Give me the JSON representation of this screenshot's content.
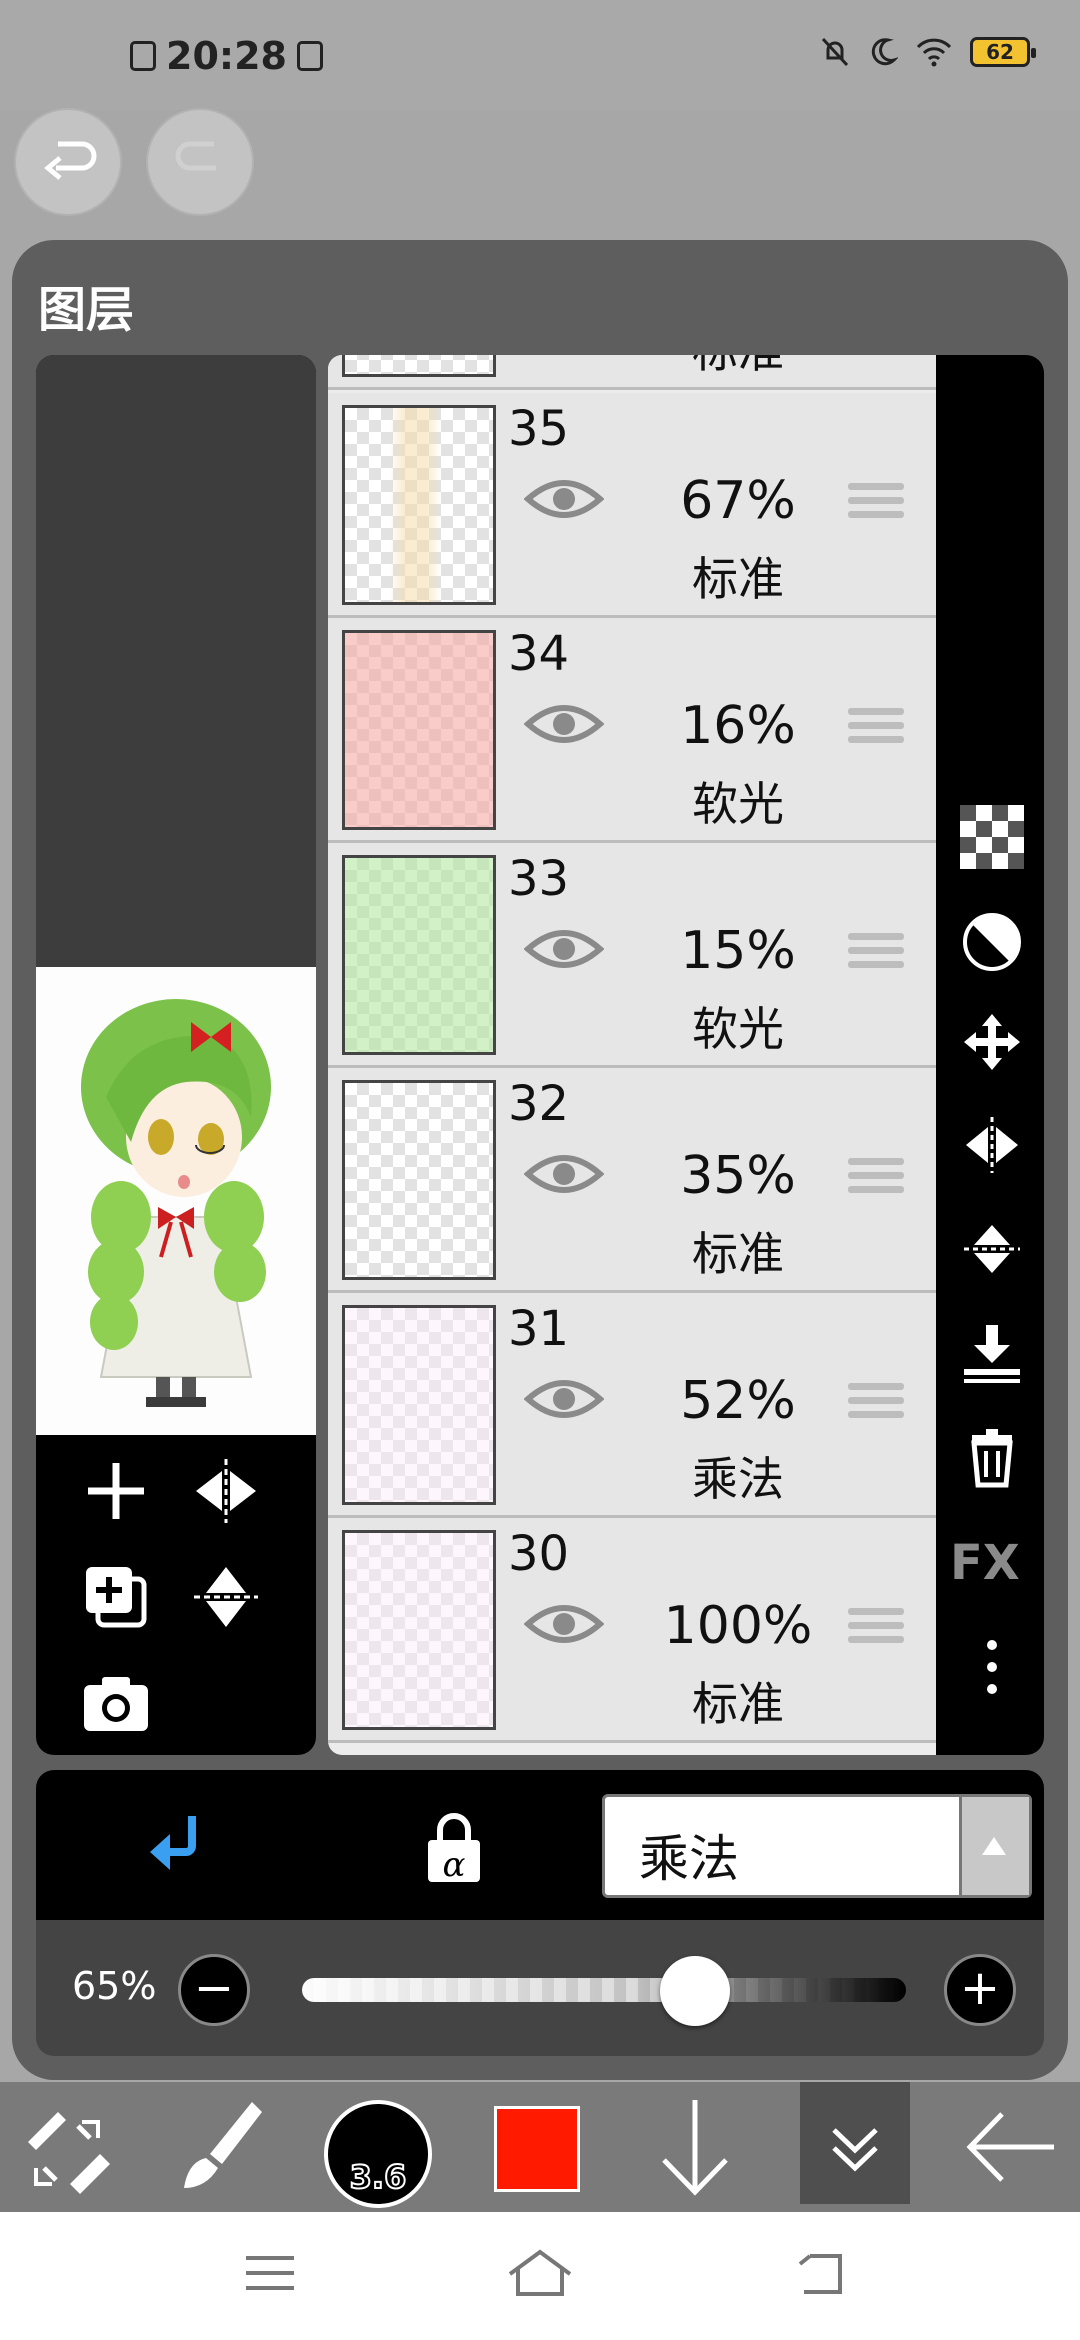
{
  "status_bar": {
    "time": "20:28",
    "battery": "62"
  },
  "panel": {
    "title": "图层"
  },
  "layers": [
    {
      "number": "",
      "opacity": "",
      "mode": "标准"
    },
    {
      "number": "35",
      "opacity": "67%",
      "mode": "标准",
      "tint": "#fbf3e2"
    },
    {
      "number": "34",
      "opacity": "16%",
      "mode": "软光",
      "tint": "#f6c3c0"
    },
    {
      "number": "33",
      "opacity": "15%",
      "mode": "软光",
      "tint": "#cdeec4"
    },
    {
      "number": "32",
      "opacity": "35%",
      "mode": "标准",
      "tint": "#ffffff"
    },
    {
      "number": "31",
      "opacity": "52%",
      "mode": "乘法",
      "tint": "#fbf6fb"
    },
    {
      "number": "30",
      "opacity": "100%",
      "mode": "标准",
      "tint": "#fbf6fb"
    }
  ],
  "right_tools": {
    "fx_label": "FX"
  },
  "blend": {
    "selected": "乘法"
  },
  "opacity_bar": {
    "label": "65%",
    "value": 0.65,
    "minus": "−",
    "plus": "+"
  },
  "toolbar": {
    "brush_size": "3.6",
    "primary_color": "#ff1a00"
  },
  "icons": {
    "undo": "undo-icon",
    "redo": "redo-icon",
    "add_layer": "plus-icon",
    "flip_horizontal": "flip-horizontal-icon",
    "copy_layer": "copy-layer-icon",
    "flip_vertical": "flip-vertical-icon",
    "camera": "camera-icon",
    "checker": "checker-icon",
    "invert": "invert-icon",
    "move": "move-icon",
    "merge_down": "merge-down-icon",
    "trash": "trash-icon",
    "more": "more-vertical-icon",
    "clip": "clip-arrow-icon",
    "alpha_lock": "alpha-lock-icon"
  }
}
